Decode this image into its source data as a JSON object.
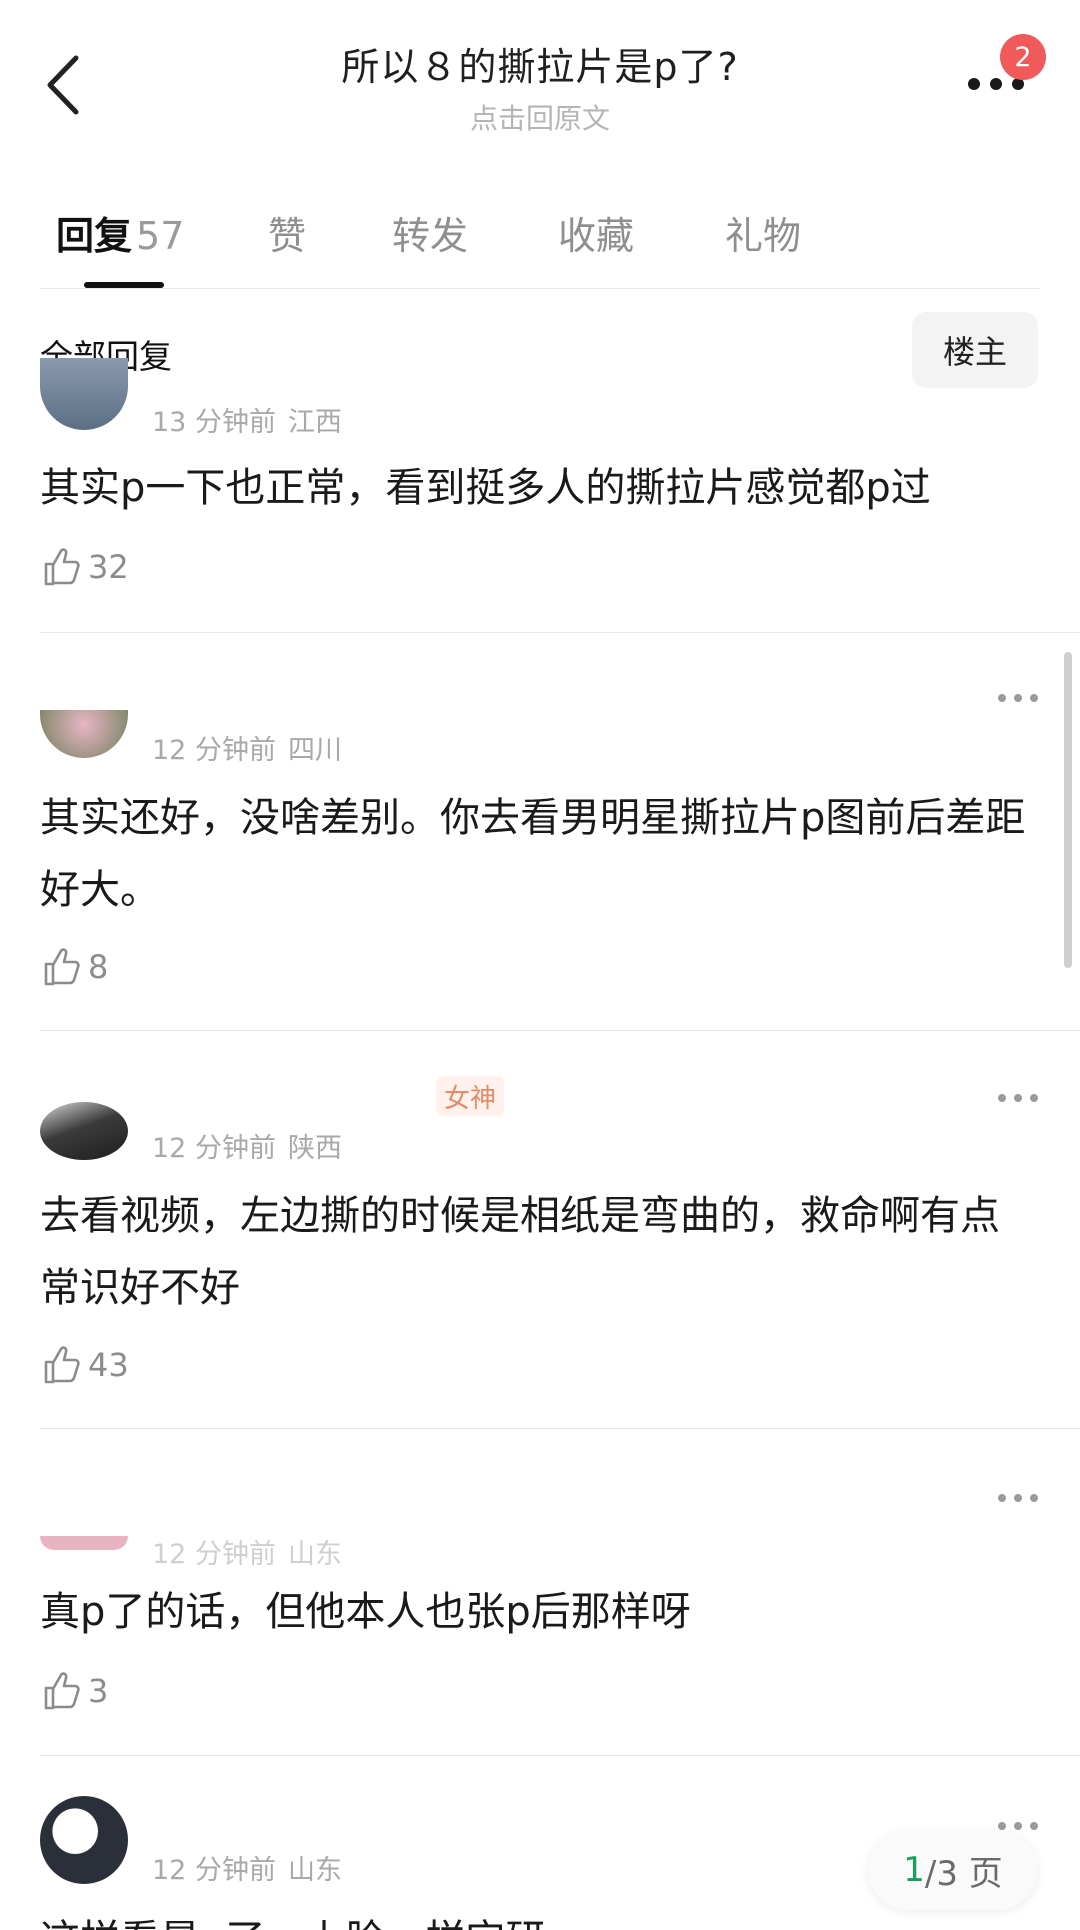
{
  "header": {
    "title": "所以８的撕拉片是p了?",
    "subtitle": "点击回原文",
    "notification_count": "2"
  },
  "tabs": [
    {
      "label": "回复",
      "count": "57"
    },
    {
      "label": "赞"
    },
    {
      "label": "转发"
    },
    {
      "label": "收藏"
    },
    {
      "label": "礼物"
    }
  ],
  "filter": {
    "all_replies": "全部回复",
    "op_only": "楼主"
  },
  "comments": [
    {
      "time": "13 分钟前",
      "location": "江西",
      "text": "其实p一下也正常，看到挺多人的撕拉片感觉都p过",
      "likes": "32"
    },
    {
      "time": "12 分钟前",
      "location": "四川",
      "text": "其实还好，没啥差别。你去看男明星撕拉片p图前后差距好大。",
      "likes": "8"
    },
    {
      "time": "12 分钟前",
      "location": "陕西",
      "tag": "女神",
      "text": "去看视频，左边撕的时候是相纸是弯曲的，救命啊有点常识好不好",
      "likes": "43"
    },
    {
      "time": "12 分钟前",
      "location": "山东",
      "text": "真p了的话，但他本人也张p后那样呀",
      "likes": "3"
    },
    {
      "time": "12 分钟前",
      "location": "山东",
      "text": "这样看是p了，上脸一样宝研"
    }
  ],
  "pagination": {
    "current": "1",
    "total": "/3 页"
  },
  "colors": {
    "badge": "#f05a5a",
    "tag_text": "#e08058",
    "page_current": "#1aa05a"
  }
}
